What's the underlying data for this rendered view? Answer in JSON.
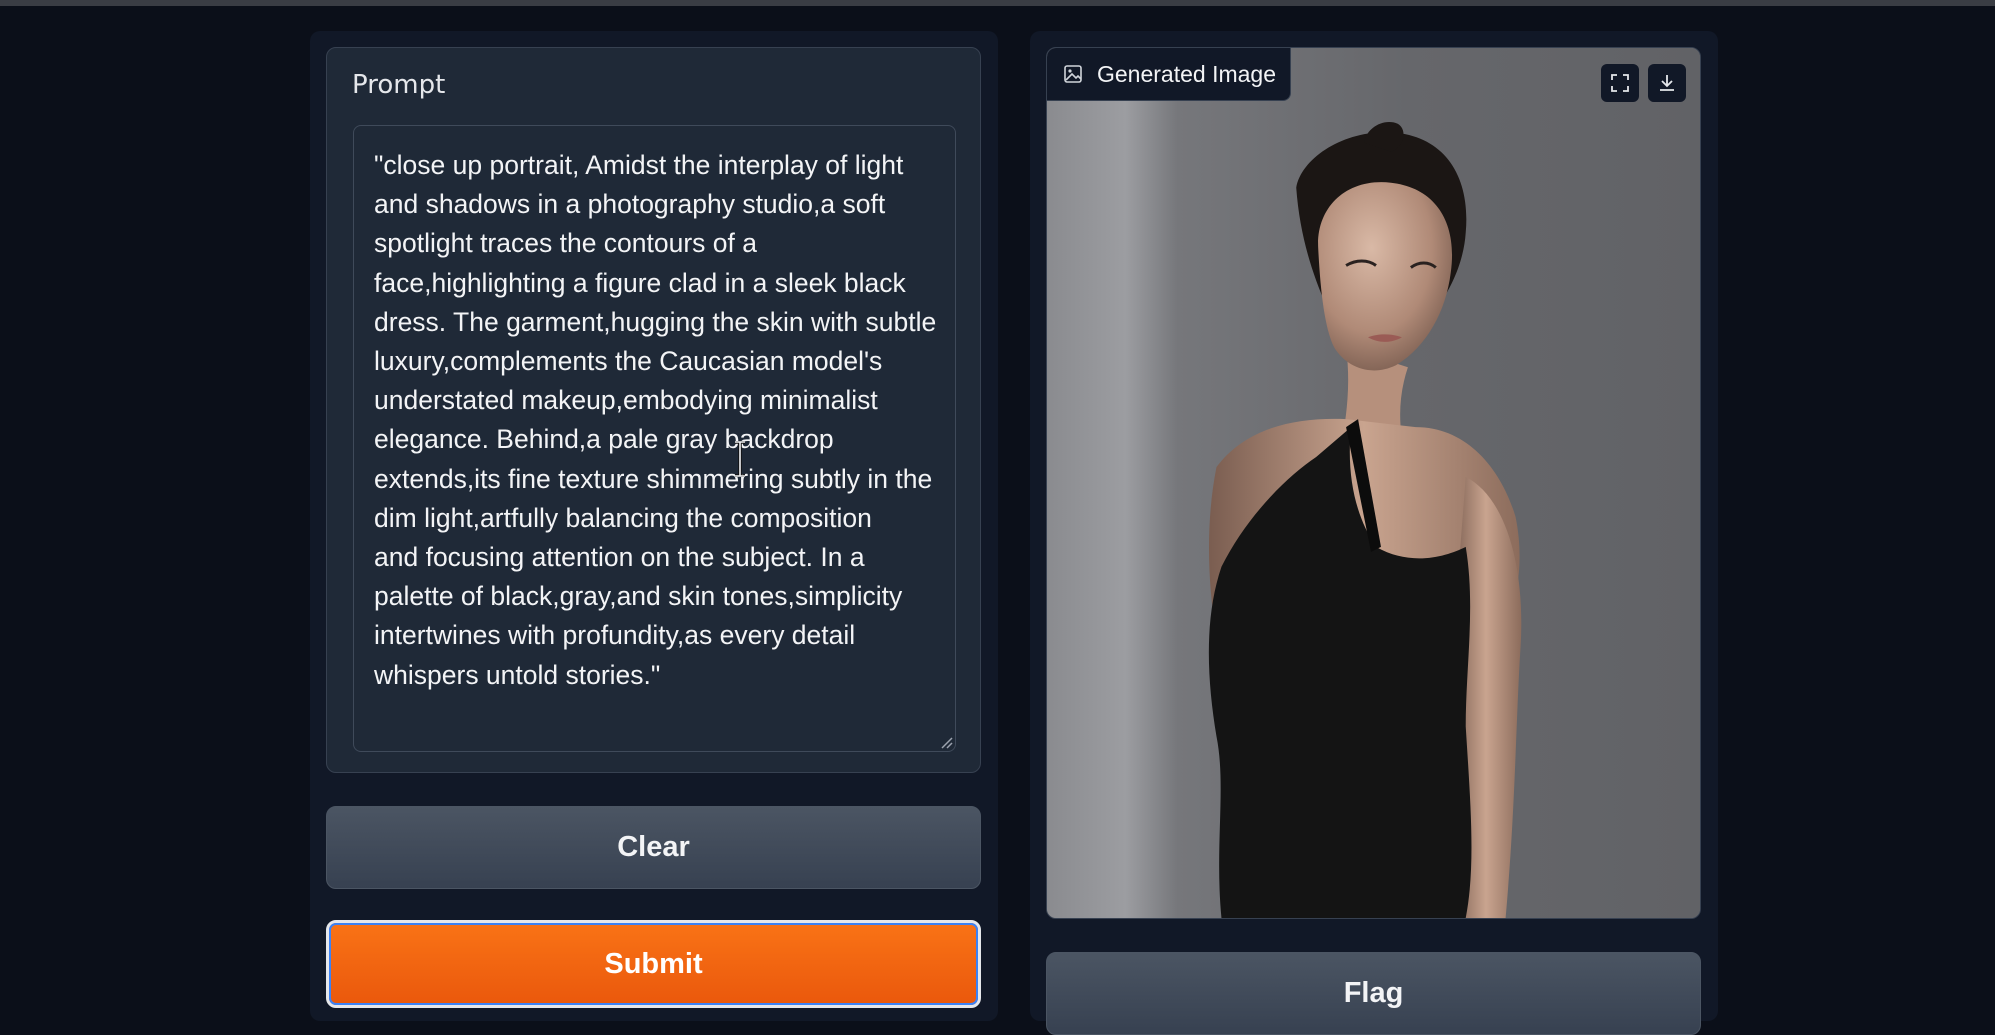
{
  "prompt": {
    "label": "Prompt",
    "value": "\"close up portrait, Amidst the interplay of light\nand shadows in a photography studio,a soft\nspotlight traces the contours of a\nface,highlighting a figure clad in a sleek black\ndress. The garment,hugging the skin with subtle\nluxury,complements the Caucasian model's\nunderstated makeup,embodying minimalist\nelegance. Behind,a pale gray backdrop\nextends,its fine texture shimmering subtly in the\ndim light,artfully balancing the composition\nand focusing attention on the subject. In a\npalette of black,gray,and skin tones,simplicity\nintertwines with profundity,as every detail\nwhispers untold stories.\""
  },
  "buttons": {
    "clear": "Clear",
    "submit": "Submit",
    "flag": "Flag"
  },
  "output": {
    "label": "Generated Image",
    "label_icon": "image-icon",
    "actions": [
      "fullscreen-icon",
      "download-icon"
    ]
  },
  "colors": {
    "background": "#0b0f19",
    "panel": "#111827",
    "block": "#1f2937",
    "border": "#374151",
    "submit": "#f97316",
    "secondary_button": "#4b5563"
  }
}
